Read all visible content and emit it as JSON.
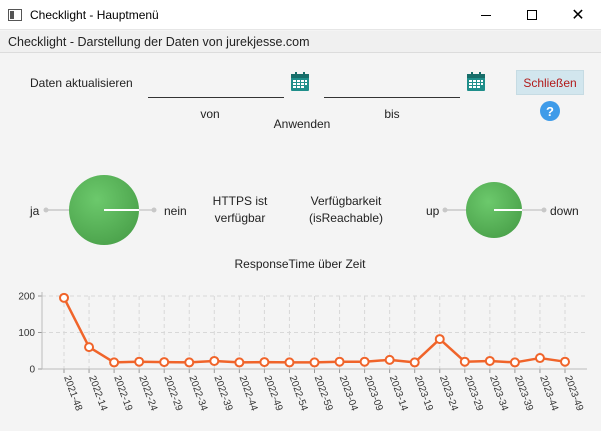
{
  "window": {
    "title": "Checklight - Hauptmenü",
    "close_glyph": "✕"
  },
  "subheader": "Checklight - Darstellung der Daten von jurekjesse.com",
  "filter": {
    "refresh_label": "Daten aktualisieren",
    "from_value": "",
    "from_caption": "von",
    "to_value": "",
    "to_caption": "bis",
    "apply_label": "Anwenden",
    "close_label": "Schließen",
    "help_glyph": "?"
  },
  "https_gauge": {
    "left_label": "ja",
    "right_label": "nein",
    "caption_line1": "HTTPS ist",
    "caption_line2": "verfügbar"
  },
  "reach_gauge": {
    "caption_line1": "Verfügbarkeit",
    "caption_line2": "(isReachable)",
    "left_label": "up",
    "right_label": "down"
  },
  "colors": {
    "gauge_green": "#5cb85c",
    "line_orange": "#f0642a",
    "close_text": "#b21a1a",
    "help_blue": "#3e9be9",
    "calendar_teal": "#1f8e8a"
  },
  "chart_data": {
    "type": "line",
    "title": "ResponseTime über Zeit",
    "xlabel": "",
    "ylabel": "",
    "ylim": [
      0,
      200
    ],
    "yticks": [
      0,
      100,
      200
    ],
    "grid": true,
    "categories": [
      "2021-48",
      "2022-14",
      "2022-19",
      "2022-24",
      "2022-29",
      "2022-34",
      "2022-39",
      "2022-44",
      "2022-49",
      "2022-54",
      "2022-59",
      "2023-04",
      "2023-09",
      "2023-14",
      "2023-19",
      "2023-24",
      "2023-29",
      "2023-34",
      "2023-39",
      "2023-44",
      "2023-49"
    ],
    "values": [
      195,
      60,
      18,
      20,
      19,
      18,
      22,
      18,
      19,
      18,
      18,
      20,
      20,
      25,
      18,
      82,
      20,
      22,
      18,
      30,
      20
    ]
  }
}
